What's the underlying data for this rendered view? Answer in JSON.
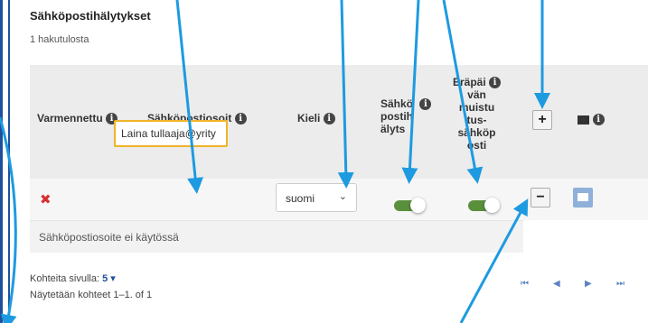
{
  "section": {
    "title": "Sähköpostihälytykset",
    "result_count": "1 hakutulosta"
  },
  "table": {
    "headers": {
      "verified": "Varmennettu",
      "email_line1": "Sähköpostiosoit",
      "email_line2": "e",
      "language": "Kieli",
      "alert_line1": "Sähkö",
      "alert_line2": "postih",
      "alert_line3": "älyts",
      "due_line1": "Eräpäi",
      "due_line2": "vän",
      "due_line3": "muistu",
      "due_line4": "tus-",
      "due_line5": "sähköp",
      "due_line6": "osti",
      "add_label": "+"
    },
    "row": {
      "verified_icon": "x-icon",
      "email_value": "Laina tullaaja@yrity",
      "language_value": "suomi",
      "alert_enabled": true,
      "due_reminder_enabled": true,
      "remove_label": "−"
    },
    "disabled_note": "Sähköpostiosoite ei käytössä"
  },
  "footer": {
    "per_page_label": "Kohteita sivulla:",
    "per_page_value": "5 ▾",
    "showing": "Näytetään kohteet 1–1. of 1"
  },
  "colors": {
    "accent_blue": "#1c4f9c",
    "arrow_blue": "#1e9be0",
    "toggle_green": "#5a8f3c",
    "focus_yellow": "#f0b429",
    "error_red": "#d63031"
  }
}
